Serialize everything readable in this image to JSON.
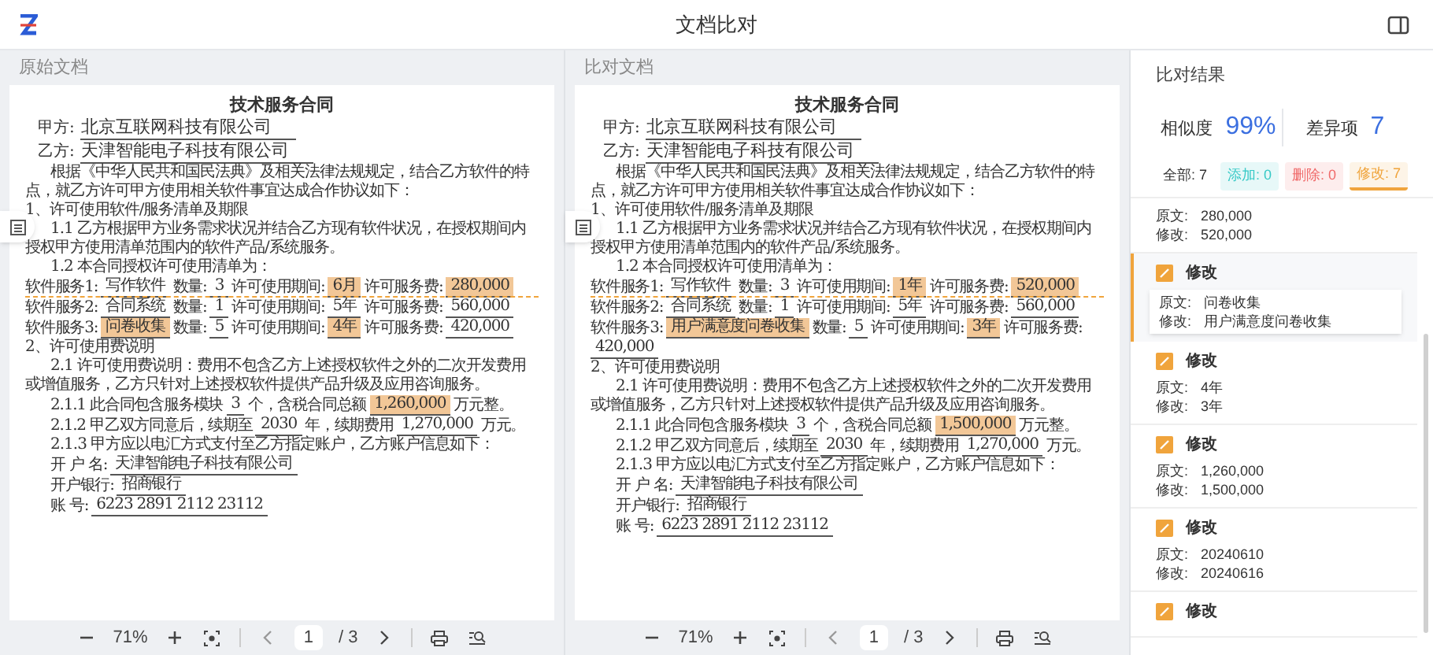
{
  "app": {
    "title": "文档比对"
  },
  "documents": [
    {
      "header": "原始文档",
      "lines": [
        {
          "kind": "title",
          "parts": [
            {
              "kind": "text",
              "text": "技术服务合同"
            }
          ]
        },
        {
          "kind": "party",
          "parts": [
            {
              "kind": "text",
              "text": "甲方:"
            },
            {
              "kind": "field",
              "text": "北京互联网科技有限公司",
              "changed": false
            }
          ]
        },
        {
          "kind": "party",
          "parts": [
            {
              "kind": "text",
              "text": "乙方:"
            },
            {
              "kind": "field",
              "text": "天津智能电子科技有限公司",
              "changed": false
            }
          ]
        },
        {
          "kind": "para",
          "indent": true,
          "parts": [
            {
              "kind": "text",
              "text": "根据《中华人民共和国民法典》及相关法律法规规定，结合乙方软件的特点，就乙方许可甲方使用相关软件事宜达成合作协议如下："
            }
          ]
        },
        {
          "kind": "para",
          "indent": false,
          "parts": [
            {
              "kind": "text",
              "text": "1、许可使用软件/服务清单及期限"
            }
          ]
        },
        {
          "kind": "para",
          "indent": true,
          "parts": [
            {
              "kind": "text",
              "text": "1.1 乙方根据甲方业务需求状况并结合乙方现有软件状况，在授权期间内授权甲方使用清单范围内的软件产品/系统服务。"
            }
          ]
        },
        {
          "kind": "para",
          "indent": true,
          "parts": [
            {
              "kind": "text",
              "text": "1.2 本合同授权许可使用清单为："
            }
          ]
        },
        {
          "kind": "row",
          "indent": false,
          "parts": [
            {
              "kind": "text",
              "text": "软件服务1:"
            },
            {
              "kind": "field",
              "text": "写作软件",
              "changed": false
            },
            {
              "kind": "text",
              "text": "数量:"
            },
            {
              "kind": "field",
              "text": "3",
              "changed": false
            },
            {
              "kind": "text",
              "text": "许可使用期间:"
            },
            {
              "kind": "field",
              "text": "6月",
              "changed": true
            },
            {
              "kind": "text",
              "text": "许可服务费:"
            },
            {
              "kind": "field",
              "text": "280,000",
              "changed": true
            }
          ]
        },
        {
          "kind": "row",
          "indent": false,
          "linked": true,
          "parts": [
            {
              "kind": "text",
              "text": "软件服务2:"
            },
            {
              "kind": "field",
              "text": "合同系统",
              "changed": false
            },
            {
              "kind": "text",
              "text": "数量:"
            },
            {
              "kind": "field",
              "text": "1",
              "changed": false
            },
            {
              "kind": "text",
              "text": "许可使用期间:"
            },
            {
              "kind": "field",
              "text": "5年",
              "changed": false
            },
            {
              "kind": "text",
              "text": "许可服务费:"
            },
            {
              "kind": "field",
              "text": "560,000",
              "changed": false
            }
          ]
        },
        {
          "kind": "row",
          "indent": false,
          "parts": [
            {
              "kind": "text",
              "text": "软件服务3:"
            },
            {
              "kind": "field",
              "text": "问卷收集",
              "changed": true
            },
            {
              "kind": "text",
              "text": "数量:"
            },
            {
              "kind": "field",
              "text": "5",
              "changed": false
            },
            {
              "kind": "text",
              "text": "许可使用期间:"
            },
            {
              "kind": "field",
              "text": "4年",
              "changed": true
            },
            {
              "kind": "text",
              "text": "许可服务费:"
            },
            {
              "kind": "field",
              "text": "420,000",
              "changed": false
            }
          ]
        },
        {
          "kind": "para",
          "indent": false,
          "parts": [
            {
              "kind": "text",
              "text": "2、许可使用费说明"
            }
          ]
        },
        {
          "kind": "para",
          "indent": true,
          "parts": [
            {
              "kind": "text",
              "text": "2.1 许可使用费说明：费用不包含乙方上述授权软件之外的二次开发费用或增值服务，乙方只针对上述授权软件提供产品升级及应用咨询服务。"
            }
          ]
        },
        {
          "kind": "row",
          "indent": true,
          "parts": [
            {
              "kind": "text",
              "text": "2.1.1 此合同包含服务模块"
            },
            {
              "kind": "field",
              "text": "3",
              "changed": false
            },
            {
              "kind": "text",
              "text": "个，含税合同总额"
            },
            {
              "kind": "field",
              "text": "1,260,000",
              "changed": true
            },
            {
              "kind": "text",
              "text": "万元整。"
            }
          ]
        },
        {
          "kind": "row",
          "indent": true,
          "parts": [
            {
              "kind": "text",
              "text": "2.1.2 甲乙双方同意后，续期至"
            },
            {
              "kind": "field",
              "text": "2030",
              "changed": false
            },
            {
              "kind": "text",
              "text": "年，续期费用"
            },
            {
              "kind": "field",
              "text": "1,270,000",
              "changed": false
            },
            {
              "kind": "text",
              "text": "万元。"
            }
          ]
        },
        {
          "kind": "para",
          "indent": true,
          "parts": [
            {
              "kind": "text",
              "text": "2.1.3 甲方应以电汇方式支付至乙方指定账户，乙方账户信息如下："
            }
          ]
        },
        {
          "kind": "row",
          "indent": true,
          "parts": [
            {
              "kind": "text",
              "text": "开 户 名:"
            },
            {
              "kind": "field",
              "text": "天津智能电子科技有限公司",
              "changed": false
            }
          ]
        },
        {
          "kind": "row",
          "indent": true,
          "parts": [
            {
              "kind": "text",
              "text": "开户银行:"
            },
            {
              "kind": "field",
              "text": "招商银行",
              "changed": false
            }
          ]
        },
        {
          "kind": "row",
          "indent": true,
          "parts": [
            {
              "kind": "text",
              "text": "账 号:"
            },
            {
              "kind": "field",
              "text": "6223 2891 2112 23112",
              "changed": false
            }
          ]
        }
      ],
      "toolbar": {
        "zoom": "71%",
        "page": "1",
        "total": "/ 3"
      }
    },
    {
      "header": "比对文档",
      "lines": [
        {
          "kind": "title",
          "parts": [
            {
              "kind": "text",
              "text": "技术服务合同"
            }
          ]
        },
        {
          "kind": "party",
          "parts": [
            {
              "kind": "text",
              "text": "甲方:"
            },
            {
              "kind": "field",
              "text": "北京互联网科技有限公司",
              "changed": false
            }
          ]
        },
        {
          "kind": "party",
          "parts": [
            {
              "kind": "text",
              "text": "乙方:"
            },
            {
              "kind": "field",
              "text": "天津智能电子科技有限公司",
              "changed": false
            }
          ]
        },
        {
          "kind": "para",
          "indent": true,
          "parts": [
            {
              "kind": "text",
              "text": "根据《中华人民共和国民法典》及相关法律法规规定，结合乙方软件的特点，就乙方许可甲方使用相关软件事宜达成合作协议如下："
            }
          ]
        },
        {
          "kind": "para",
          "indent": false,
          "parts": [
            {
              "kind": "text",
              "text": "1、许可使用软件/服务清单及期限"
            }
          ]
        },
        {
          "kind": "para",
          "indent": true,
          "parts": [
            {
              "kind": "text",
              "text": "1.1 乙方根据甲方业务需求状况并结合乙方现有软件状况，在授权期间内授权甲方使用清单范围内的软件产品/系统服务。"
            }
          ]
        },
        {
          "kind": "para",
          "indent": true,
          "parts": [
            {
              "kind": "text",
              "text": "1.2 本合同授权许可使用清单为："
            }
          ]
        },
        {
          "kind": "row",
          "indent": false,
          "parts": [
            {
              "kind": "text",
              "text": "软件服务1:"
            },
            {
              "kind": "field",
              "text": "写作软件",
              "changed": false
            },
            {
              "kind": "text",
              "text": "数量:"
            },
            {
              "kind": "field",
              "text": "3",
              "changed": false
            },
            {
              "kind": "text",
              "text": "许可使用期间:"
            },
            {
              "kind": "field",
              "text": "1年",
              "changed": true
            },
            {
              "kind": "text",
              "text": "许可服务费:"
            },
            {
              "kind": "field",
              "text": "520,000",
              "changed": true
            }
          ]
        },
        {
          "kind": "row",
          "indent": false,
          "linked": true,
          "parts": [
            {
              "kind": "text",
              "text": "软件服务2:"
            },
            {
              "kind": "field",
              "text": "合同系统",
              "changed": false
            },
            {
              "kind": "text",
              "text": "数量:"
            },
            {
              "kind": "field",
              "text": "1",
              "changed": false
            },
            {
              "kind": "text",
              "text": "许可使用期间:"
            },
            {
              "kind": "field",
              "text": "5年",
              "changed": false
            },
            {
              "kind": "text",
              "text": "许可服务费:"
            },
            {
              "kind": "field",
              "text": "560,000",
              "changed": false
            }
          ]
        },
        {
          "kind": "row",
          "indent": false,
          "parts": [
            {
              "kind": "text",
              "text": "软件服务3:"
            },
            {
              "kind": "field",
              "text": "用户满意度问卷收集",
              "changed": true
            },
            {
              "kind": "text",
              "text": "数量:"
            },
            {
              "kind": "field",
              "text": "5",
              "changed": false
            },
            {
              "kind": "text",
              "text": "许可使用期间:"
            },
            {
              "kind": "field",
              "text": "3年",
              "changed": true
            },
            {
              "kind": "text",
              "text": "许可服务费:"
            },
            {
              "kind": "field",
              "text": "420,000",
              "changed": false
            }
          ]
        },
        {
          "kind": "para",
          "indent": false,
          "parts": [
            {
              "kind": "text",
              "text": "2、许可使用费说明"
            }
          ]
        },
        {
          "kind": "para",
          "indent": true,
          "parts": [
            {
              "kind": "text",
              "text": "2.1 许可使用费说明：费用不包含乙方上述授权软件之外的二次开发费用或增值服务，乙方只针对上述授权软件提供产品升级及应用咨询服务。"
            }
          ]
        },
        {
          "kind": "row",
          "indent": true,
          "parts": [
            {
              "kind": "text",
              "text": "2.1.1 此合同包含服务模块"
            },
            {
              "kind": "field",
              "text": "3",
              "changed": false
            },
            {
              "kind": "text",
              "text": "个，含税合同总额"
            },
            {
              "kind": "field",
              "text": "1,500,000",
              "changed": true
            },
            {
              "kind": "text",
              "text": "万元整。"
            }
          ]
        },
        {
          "kind": "row",
          "indent": true,
          "parts": [
            {
              "kind": "text",
              "text": "2.1.2 甲乙双方同意后，续期至"
            },
            {
              "kind": "field",
              "text": "2030",
              "changed": false
            },
            {
              "kind": "text",
              "text": "年，续期费用"
            },
            {
              "kind": "field",
              "text": "1,270,000",
              "changed": false
            },
            {
              "kind": "text",
              "text": "万元。"
            }
          ]
        },
        {
          "kind": "para",
          "indent": true,
          "parts": [
            {
              "kind": "text",
              "text": "2.1.3 甲方应以电汇方式支付至乙方指定账户，乙方账户信息如下："
            }
          ]
        },
        {
          "kind": "row",
          "indent": true,
          "parts": [
            {
              "kind": "text",
              "text": "开 户 名:"
            },
            {
              "kind": "field",
              "text": "天津智能电子科技有限公司",
              "changed": false
            }
          ]
        },
        {
          "kind": "row",
          "indent": true,
          "parts": [
            {
              "kind": "text",
              "text": "开户银行:"
            },
            {
              "kind": "field",
              "text": "招商银行",
              "changed": false
            }
          ]
        },
        {
          "kind": "row",
          "indent": true,
          "parts": [
            {
              "kind": "text",
              "text": "账 号:"
            },
            {
              "kind": "field",
              "text": "6223 2891 2112 23112",
              "changed": false
            }
          ]
        }
      ],
      "toolbar": {
        "zoom": "71%",
        "page": "1",
        "total": "/ 3"
      }
    }
  ],
  "results": {
    "title": "比对结果",
    "similarity_label": "相似度",
    "similarity": "99%",
    "diff_label": "差异项",
    "diff_count": "7",
    "filters": [
      {
        "label": "全部: 7",
        "color": "#333333",
        "selected": false
      },
      {
        "label": "添加: 0",
        "color": "#36c9c6",
        "selected": false
      },
      {
        "label": "删除: 0",
        "color": "#f06a6a",
        "selected": false
      },
      {
        "label": "修改: 7",
        "color": "#f0a43c",
        "selected": true
      }
    ],
    "items": [
      {
        "original_label": "原文:",
        "original": "280,000",
        "modified_label": "修改:",
        "modified": "520,000",
        "selected": false
      },
      {
        "label": "修改",
        "original_label": "原文:",
        "original": "问卷收集",
        "modified_label": "修改:",
        "modified": "用户满意度问卷收集",
        "selected": true
      },
      {
        "label": "修改",
        "original_label": "原文:",
        "original": "4年",
        "modified_label": "修改:",
        "modified": "3年",
        "selected": false
      },
      {
        "label": "修改",
        "original_label": "原文:",
        "original": "1,260,000",
        "modified_label": "修改:",
        "modified": "1,500,000",
        "selected": false
      },
      {
        "label": "修改",
        "original_label": "原文:",
        "original": "20240610",
        "modified_label": "修改:",
        "modified": "20240616",
        "selected": false
      },
      {
        "label": "修改",
        "selected": false
      }
    ]
  }
}
